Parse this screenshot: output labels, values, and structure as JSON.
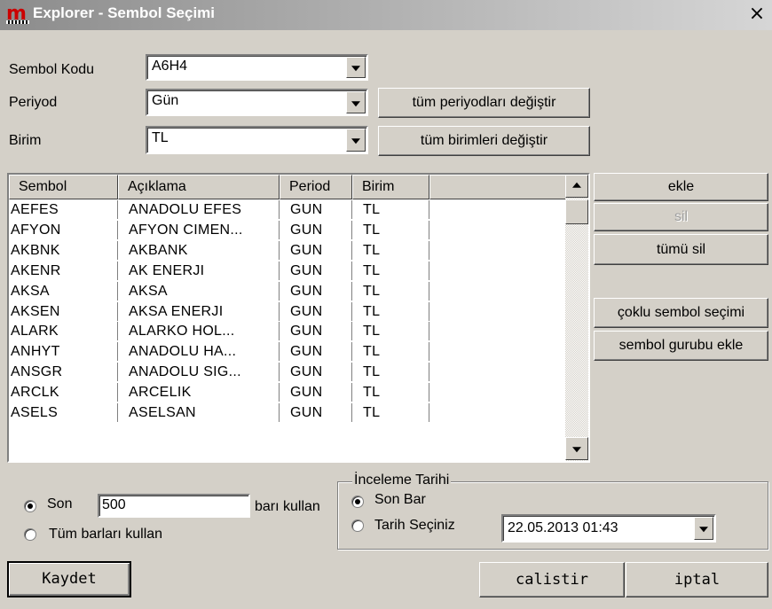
{
  "window": {
    "title": "Explorer - Sembol Seçimi",
    "close": "×"
  },
  "form": {
    "sembol_kodu": {
      "label": "Sembol Kodu",
      "value": "A6H4"
    },
    "periyod": {
      "label": "Periyod",
      "value": "Gün",
      "button": "tüm periyodları değiştir"
    },
    "birim": {
      "label": "Birim",
      "value": "TL",
      "button": "tüm birimleri değiştir"
    }
  },
  "table": {
    "headers": [
      "Sembol",
      "Açıklama",
      "Period",
      "Birim",
      ""
    ],
    "rows": [
      [
        "AEFES",
        "ANADOLU EFES",
        "GUN",
        "TL"
      ],
      [
        "AFYON",
        "AFYON CIMEN...",
        "GUN",
        "TL"
      ],
      [
        "AKBNK",
        "AKBANK",
        "GUN",
        "TL"
      ],
      [
        "AKENR",
        "AK ENERJI",
        "GUN",
        "TL"
      ],
      [
        "AKSA",
        "AKSA",
        "GUN",
        "TL"
      ],
      [
        "AKSEN",
        "AKSA ENERJI",
        "GUN",
        "TL"
      ],
      [
        "ALARK",
        "ALARKO HOL...",
        "GUN",
        "TL"
      ],
      [
        "ANHYT",
        "ANADOLU HA...",
        "GUN",
        "TL"
      ],
      [
        "ANSGR",
        "ANADOLU SIG...",
        "GUN",
        "TL"
      ],
      [
        "ARCLK",
        "ARCELIK",
        "GUN",
        "TL"
      ],
      [
        "ASELS",
        "ASELSAN",
        "GUN",
        "TL"
      ]
    ]
  },
  "side_buttons": {
    "ekle": "ekle",
    "sil": "sil",
    "tumu_sil": "tümü sil",
    "coklu": "çoklu sembol seçimi",
    "gurubu": "sembol gurubu ekle"
  },
  "bars": {
    "son_label": "Son",
    "son_value": "500",
    "suffix": "barı kullan",
    "tum_label": "Tüm barları kullan",
    "selected": "son"
  },
  "inceleme": {
    "legend": "İnceleme Tarihi",
    "son_bar": "Son Bar",
    "tarih_seciniz": "Tarih Seçiniz",
    "date_value": "22.05.2013 01:43",
    "selected": "son_bar"
  },
  "footer": {
    "kaydet": "Kaydet",
    "calistir": "calistir",
    "iptal": "iptal"
  }
}
